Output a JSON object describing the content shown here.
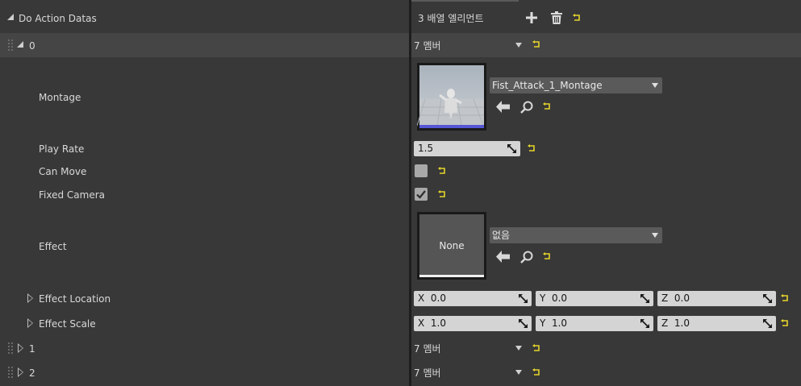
{
  "header": {
    "property_label": "Do Action Datas",
    "array_count": "3 배열 엘리먼트",
    "add_icon": "plus-icon",
    "delete_icon": "trash-icon",
    "reset_icon": "reset-arrow-icon"
  },
  "elements": [
    {
      "index": "0",
      "value": "7 멤버",
      "expanded": true
    },
    {
      "index": "1",
      "value": "7 멤버",
      "expanded": false
    },
    {
      "index": "2",
      "value": "7 멤버",
      "expanded": false
    }
  ],
  "element0": {
    "montage": {
      "label": "Montage",
      "asset": "Fist_Attack_1_Montage"
    },
    "play_rate": {
      "label": "Play Rate",
      "value": "1.5"
    },
    "can_move": {
      "label": "Can Move",
      "checked": false
    },
    "fixed_camera": {
      "label": "Fixed Camera",
      "checked": true
    },
    "effect": {
      "label": "Effect",
      "thumb_text": "None",
      "asset": "없음"
    },
    "effect_location": {
      "label": "Effect Location",
      "x_label": "X",
      "x": "0.0",
      "y_label": "Y",
      "y": "0.0",
      "z_label": "Z",
      "z": "0.0"
    },
    "effect_scale": {
      "label": "Effect Scale",
      "x_label": "X",
      "x": "1.0",
      "y_label": "Y",
      "y": "1.0",
      "z_label": "Z",
      "z": "1.0"
    }
  },
  "colors": {
    "reset_icon": "#e5d42a",
    "thumbnail_bar": "#5656d6"
  }
}
